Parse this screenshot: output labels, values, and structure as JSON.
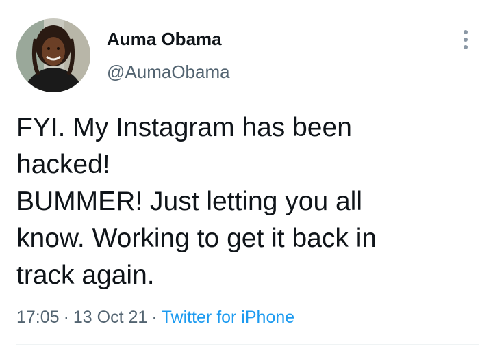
{
  "tweet": {
    "author": {
      "display_name": "Auma Obama",
      "handle": "@AumaObama"
    },
    "text_lines": [
      "FYI. My Instagram has been",
      "hacked!",
      "BUMMER! Just letting you all",
      "know. Working to get it back in",
      "track again."
    ],
    "time": "17:05",
    "date": "13 Oct 21",
    "source": "Twitter for iPhone",
    "separator": "·"
  },
  "icons": {
    "more": "more-vertical-icon",
    "avatar": "profile-photo"
  },
  "colors": {
    "text_primary": "#0f1419",
    "text_secondary": "#536471",
    "link": "#1d9bf0",
    "more_icon": "#8b98a5"
  }
}
